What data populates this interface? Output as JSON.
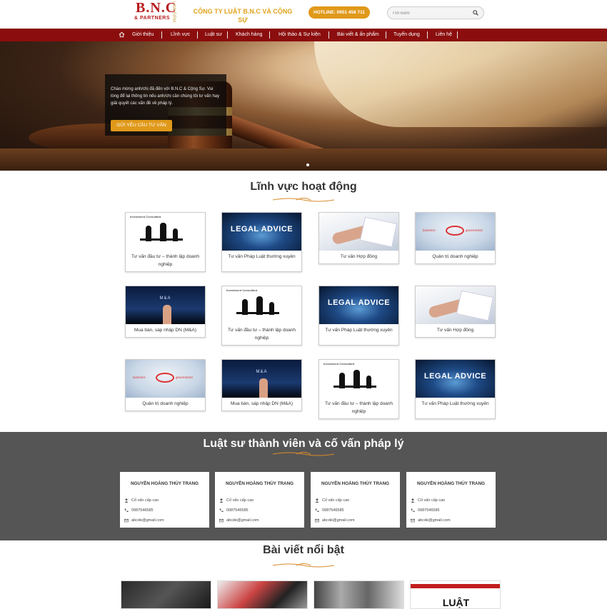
{
  "header": {
    "logo_text": "B.N.C",
    "logo_partners": "& PARTNERS",
    "logo_lawfirm": "LAW FIRM",
    "company_name": "CÔNG TY LUẬT B.N.C VÀ CỘNG SỰ",
    "hotline": "HOTLINE: 0951 458 711",
    "search_placeholder": "Tìm kiếm"
  },
  "nav": {
    "items": [
      "Giới thiệu",
      "Lĩnh vực",
      "Luật sư",
      "Khách hàng",
      "Hội thảo & Sự kiện",
      "Bài viết & ấn phẩm",
      "Tuyển dụng",
      "Liên hệ"
    ]
  },
  "hero": {
    "welcome_text": "Chào mừng anh/chị đã đến với B.N.C & Cộng Sự. Vui lòng để lại thông tin nếu anh/chị cần chúng tôi tư vấn hay giải quyết các vấn đề về pháp lý.",
    "button_label": "GỬI YÊU CẦU TƯ VẤN"
  },
  "fields": {
    "title": "Lĩnh vực hoạt động",
    "items": [
      {
        "caption": "Tư vấn đầu tư – thành lập doanh nghiệp",
        "thumb": "investment"
      },
      {
        "caption": "Tư vấn Pháp Luật thường xuyên",
        "thumb": "legal"
      },
      {
        "caption": "Tư vấn Hợp đồng",
        "thumb": "contract"
      },
      {
        "caption": "Quản trị doanh nghiệp",
        "thumb": "gov"
      },
      {
        "caption": "Mua bán, sáp nhập DN (M&A)",
        "thumb": "ma"
      },
      {
        "caption": "Tư vấn đầu tư – thành lập doanh nghiệp",
        "thumb": "investment"
      },
      {
        "caption": "Tư vấn Pháp Luật thường xuyên",
        "thumb": "legal"
      },
      {
        "caption": "Tư vấn Hợp đồng",
        "thumb": "contract"
      },
      {
        "caption": "Quản trị doanh nghiệp",
        "thumb": "gov"
      },
      {
        "caption": "Mua bán, sáp nhập DN (M&A)",
        "thumb": "ma"
      },
      {
        "caption": "Tư vấn đầu tư – thành lập doanh nghiệp",
        "thumb": "investment"
      },
      {
        "caption": "Tư vấn Pháp Luật thường xuyên",
        "thumb": "legal"
      }
    ],
    "thumb_text": {
      "legal": "LEGAL ADVICE",
      "ma": "M&A",
      "investment": "Investment Consultant",
      "business": "business",
      "government": "government"
    }
  },
  "lawyers": {
    "title": "Luật sư thành viên và cố vấn pháp lý",
    "items": [
      {
        "name": "NGUYỄN HOÀNG THÙY TRANG",
        "role": "Cố vấn cấp cao",
        "phone": "0987546585",
        "email": "abcde@gmail.com"
      },
      {
        "name": "NGUYỄN HOÀNG THÙY TRANG",
        "role": "Cố vấn cấp cao",
        "phone": "0987546585",
        "email": "abcde@gmail.com"
      },
      {
        "name": "NGUYỄN HOÀNG THÙY TRANG",
        "role": "Cố vấn cấp cao",
        "phone": "0987546585",
        "email": "abcde@gmail.com"
      },
      {
        "name": "NGUYỄN HOÀNG THÙY TRANG",
        "role": "Cố vấn cấp cao",
        "phone": "0987546585",
        "email": "abcde@gmail.com"
      }
    ]
  },
  "news": {
    "title": "Bài viết nổi bật",
    "post4_text": "LUẬT"
  },
  "colors": {
    "nav_bg": "#8b0d0d",
    "accent": "#e0991a",
    "lawyers_bg": "#555555"
  }
}
